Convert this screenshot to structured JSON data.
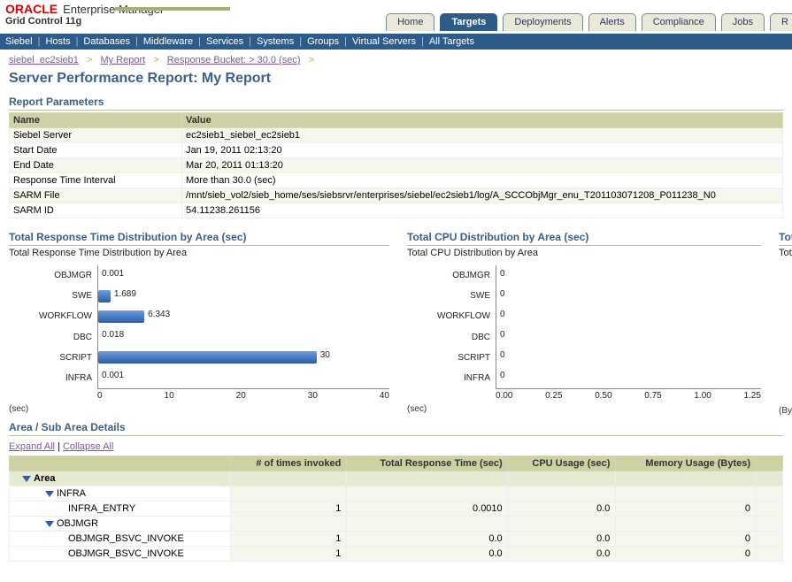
{
  "brand": {
    "oracle": "ORACLE",
    "suite": "Enterprise Manager",
    "edition": "Grid Control 11g"
  },
  "tabs": [
    "Home",
    "Targets",
    "Deployments",
    "Alerts",
    "Compliance",
    "Jobs",
    "R"
  ],
  "tabs_active_index": 1,
  "subnav": [
    "Siebel",
    "Hosts",
    "Databases",
    "Middleware",
    "Services",
    "Systems",
    "Groups",
    "Virtual Servers",
    "All Targets"
  ],
  "breadcrumb": {
    "a": "siebel_ec2sieb1",
    "b": "My Report",
    "c": "Response Bucket: > 30.0 (sec)"
  },
  "page_title": "Server Performance Report: My Report",
  "params_title": "Report Parameters",
  "params_headers": {
    "name": "Name",
    "value": "Value"
  },
  "params": [
    {
      "name": "Siebel Server",
      "value": "ec2sieb1_siebel_ec2sieb1"
    },
    {
      "name": "Start Date",
      "value": "Jan 19, 2011 02:13:20"
    },
    {
      "name": "End Date",
      "value": "Mar 20, 2011 01:13:20"
    },
    {
      "name": "Response Time Interval",
      "value": "More than 30.0 (sec)"
    },
    {
      "name": "SARM File",
      "value": "/mnt/sieb_vol2/sieb_home/ses/siebsrvr/enterprises/siebel/ec2sieb1/log/A_SCCObjMgr_enu_T201103071208_P011238_N0"
    },
    {
      "name": "SARM ID",
      "value": "54.11238.261156"
    }
  ],
  "chart_left": {
    "title": "Total Response Time Distribution by Area (sec)",
    "subtitle": "Total Response Time Distribution by Area",
    "unit": "(sec)"
  },
  "chart_right": {
    "title": "Total CPU Distribution by Area (sec)",
    "subtitle": "Total CPU Distribution by Area",
    "unit": "(sec)"
  },
  "chart_cut": {
    "title": "Tot",
    "subtitle": "Tota",
    "unit": "(Byt"
  },
  "chart_data": [
    {
      "type": "bar",
      "orientation": "horizontal",
      "title": "Total Response Time Distribution by Area (sec)",
      "categories": [
        "OBJMGR",
        "SWE",
        "WORKFLOW",
        "DBC",
        "SCRIPT",
        "INFRA"
      ],
      "values": [
        0.001,
        1.689,
        6.343,
        0.018,
        30,
        0.001
      ],
      "xlabel": "(sec)",
      "xlim": [
        0,
        40
      ],
      "xticks": [
        0,
        10,
        20,
        30,
        40
      ]
    },
    {
      "type": "bar",
      "orientation": "horizontal",
      "title": "Total CPU Distribution by Area (sec)",
      "categories": [
        "OBJMGR",
        "SWE",
        "WORKFLOW",
        "DBC",
        "SCRIPT",
        "INFRA"
      ],
      "values": [
        0,
        0,
        0,
        0,
        0,
        0
      ],
      "xlabel": "(sec)",
      "xlim": [
        0.0,
        1.25
      ],
      "xticks": [
        0.0,
        0.25,
        0.5,
        0.75,
        1.0,
        1.25
      ]
    }
  ],
  "area_section": {
    "title": "Area / Sub Area Details",
    "expand": "Expand All",
    "collapse": "Collapse All",
    "headers": {
      "col0": "",
      "col1": "# of times invoked",
      "col2": "Total Response Time (sec)",
      "col3": "CPU Usage (sec)",
      "col4": "Memory Usage (Bytes)"
    },
    "root": "Area",
    "rows": [
      {
        "indent": 2,
        "label": "INFRA",
        "expandable": true
      },
      {
        "indent": 3,
        "label": "INFRA_ENTRY",
        "c1": "1",
        "c2": "0.0010",
        "c3": "0.0",
        "c4": "0"
      },
      {
        "indent": 2,
        "label": "OBJMGR",
        "expandable": true
      },
      {
        "indent": 3,
        "label": "OBJMGR_BSVC_INVOKE",
        "c1": "1",
        "c2": "0.0",
        "c3": "0.0",
        "c4": "0"
      },
      {
        "indent": 3,
        "label": "OBJMGR_BSVC_INVOKE",
        "c1": "1",
        "c2": "0.0",
        "c3": "0.0",
        "c4": "0"
      }
    ]
  }
}
